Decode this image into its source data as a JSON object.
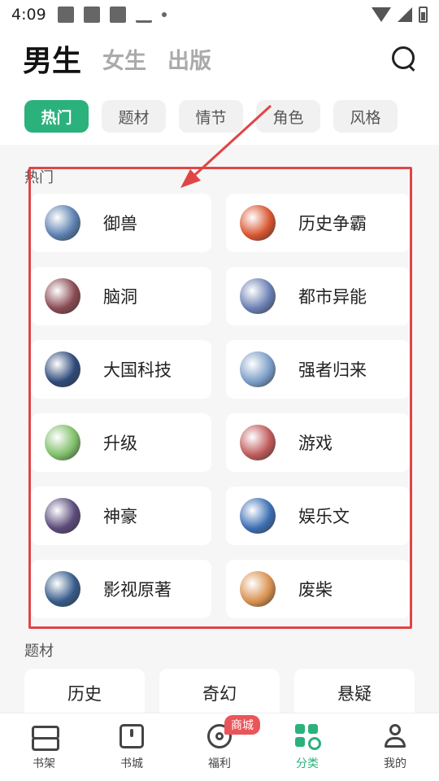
{
  "status": {
    "time": "4:09"
  },
  "header": {
    "tabs": [
      "男生",
      "女生",
      "出版"
    ],
    "active": 0
  },
  "chips": [
    "热门",
    "题材",
    "情节",
    "角色",
    "风格"
  ],
  "sections": {
    "hot": "热门",
    "theme": "题材"
  },
  "hot_items": [
    {
      "name": "御兽",
      "color": "#5b7fb0"
    },
    {
      "name": "历史争霸",
      "color": "#d9552f"
    },
    {
      "name": "脑洞",
      "color": "#8a4a52"
    },
    {
      "name": "都市异能",
      "color": "#6a7fb3"
    },
    {
      "name": "大国科技",
      "color": "#2e4a7a"
    },
    {
      "name": "强者归来",
      "color": "#7b9dc7"
    },
    {
      "name": "升级",
      "color": "#7fbf6a"
    },
    {
      "name": "游戏",
      "color": "#c05a5a"
    },
    {
      "name": "神豪",
      "color": "#5b4a7a"
    },
    {
      "name": "娱乐文",
      "color": "#3d6fb5"
    },
    {
      "name": "影视原著",
      "color": "#365b8a"
    },
    {
      "name": "废柴",
      "color": "#d9904f"
    }
  ],
  "theme_items": [
    "历史",
    "奇幻",
    "悬疑"
  ],
  "nav": [
    {
      "label": "书架",
      "icon": "shelf-icon"
    },
    {
      "label": "书城",
      "icon": "store-icon"
    },
    {
      "label": "福利",
      "icon": "gift-icon",
      "badge": "商城"
    },
    {
      "label": "分类",
      "icon": "category-icon",
      "active": true
    },
    {
      "label": "我的",
      "icon": "profile-icon"
    }
  ],
  "colors": {
    "accent": "#2bb17c",
    "highlight": "#e04545",
    "badge": "#e8565a"
  }
}
